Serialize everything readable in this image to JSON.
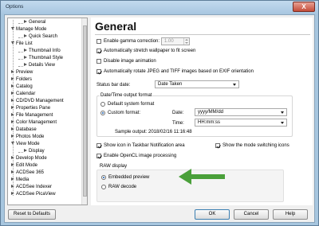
{
  "window": {
    "title": "Options",
    "close_label": "X"
  },
  "tree": {
    "items": [
      {
        "label": "General",
        "level": 1,
        "expanded": false
      },
      {
        "label": "Manage Mode",
        "level": 0,
        "expanded": true
      },
      {
        "label": "Quick Search",
        "level": 1,
        "expanded": false
      },
      {
        "label": "File List",
        "level": 0,
        "expanded": true
      },
      {
        "label": "Thumbnail Info",
        "level": 1,
        "expanded": false
      },
      {
        "label": "Thumbnail Style",
        "level": 1,
        "expanded": false
      },
      {
        "label": "Details View",
        "level": 1,
        "expanded": false
      },
      {
        "label": "Preview",
        "level": 0,
        "expanded": false
      },
      {
        "label": "Folders",
        "level": 0,
        "expanded": false
      },
      {
        "label": "Catalog",
        "level": 0,
        "expanded": false
      },
      {
        "label": "Calendar",
        "level": 0,
        "expanded": false
      },
      {
        "label": "CD/DVD Management",
        "level": 0,
        "expanded": false
      },
      {
        "label": "Properties Pane",
        "level": 0,
        "expanded": false
      },
      {
        "label": "File Management",
        "level": 0,
        "expanded": false
      },
      {
        "label": "Color Management",
        "level": 0,
        "expanded": false
      },
      {
        "label": "Database",
        "level": 0,
        "expanded": false
      },
      {
        "label": "Photos Mode",
        "level": 0,
        "expanded": false
      },
      {
        "label": "View Mode",
        "level": 0,
        "expanded": true
      },
      {
        "label": "Display",
        "level": 1,
        "expanded": false
      },
      {
        "label": "Develop Mode",
        "level": 0,
        "expanded": false
      },
      {
        "label": "Edit Mode",
        "level": 0,
        "expanded": false
      },
      {
        "label": "ACDSee 365",
        "level": 0,
        "expanded": false
      },
      {
        "label": "Media",
        "level": 0,
        "expanded": false
      },
      {
        "label": "ACDSee Indexer",
        "level": 0,
        "expanded": false
      },
      {
        "label": "ACDSee PicaView",
        "level": 0,
        "expanded": false
      }
    ]
  },
  "general": {
    "heading": "General",
    "gamma_label": "Enable gamma correction:",
    "gamma_value": "1.00",
    "gamma_checked": false,
    "stretch_label": "Automatically stretch wallpaper to fit screen",
    "stretch_checked": true,
    "disable_anim_label": "Disable image animation",
    "disable_anim_checked": false,
    "rotate_label": "Automatically rotate JPEG and TIFF images based on EXIF orientation",
    "rotate_checked": true,
    "statusbar_label": "Status bar date:",
    "statusbar_value": "Date Taken",
    "datetime_group": "Date/Time output format",
    "default_format_label": "Default system format",
    "custom_format_label": "Custom format:",
    "date_label": "Date:",
    "date_value": "yyyy/MM/dd",
    "time_label": "Time:",
    "time_value": "HH:mm:ss",
    "sample_label": "Sample output:",
    "sample_value": "2018/02/16 11:16:48",
    "taskbar_label": "Show icon in Taskbar Notification area",
    "taskbar_checked": true,
    "modeswitch_label": "Show the mode switching icons",
    "modeswitch_checked": true,
    "opencl_label": "Enable OpenCL image processing",
    "opencl_checked": true,
    "raw_group": "RAW display",
    "embedded_label": "Embedded preview",
    "rawdecode_label": "RAW decode",
    "raw_selected": "Embedded preview"
  },
  "footer": {
    "reset_label": "Reset to Defaults",
    "ok_label": "OK",
    "cancel_label": "Cancel",
    "help_label": "Help"
  },
  "colors": {
    "arrow": "#4aa03a",
    "title_bar": "#b6d1e8",
    "radio_dot": "#1c5fb0"
  }
}
